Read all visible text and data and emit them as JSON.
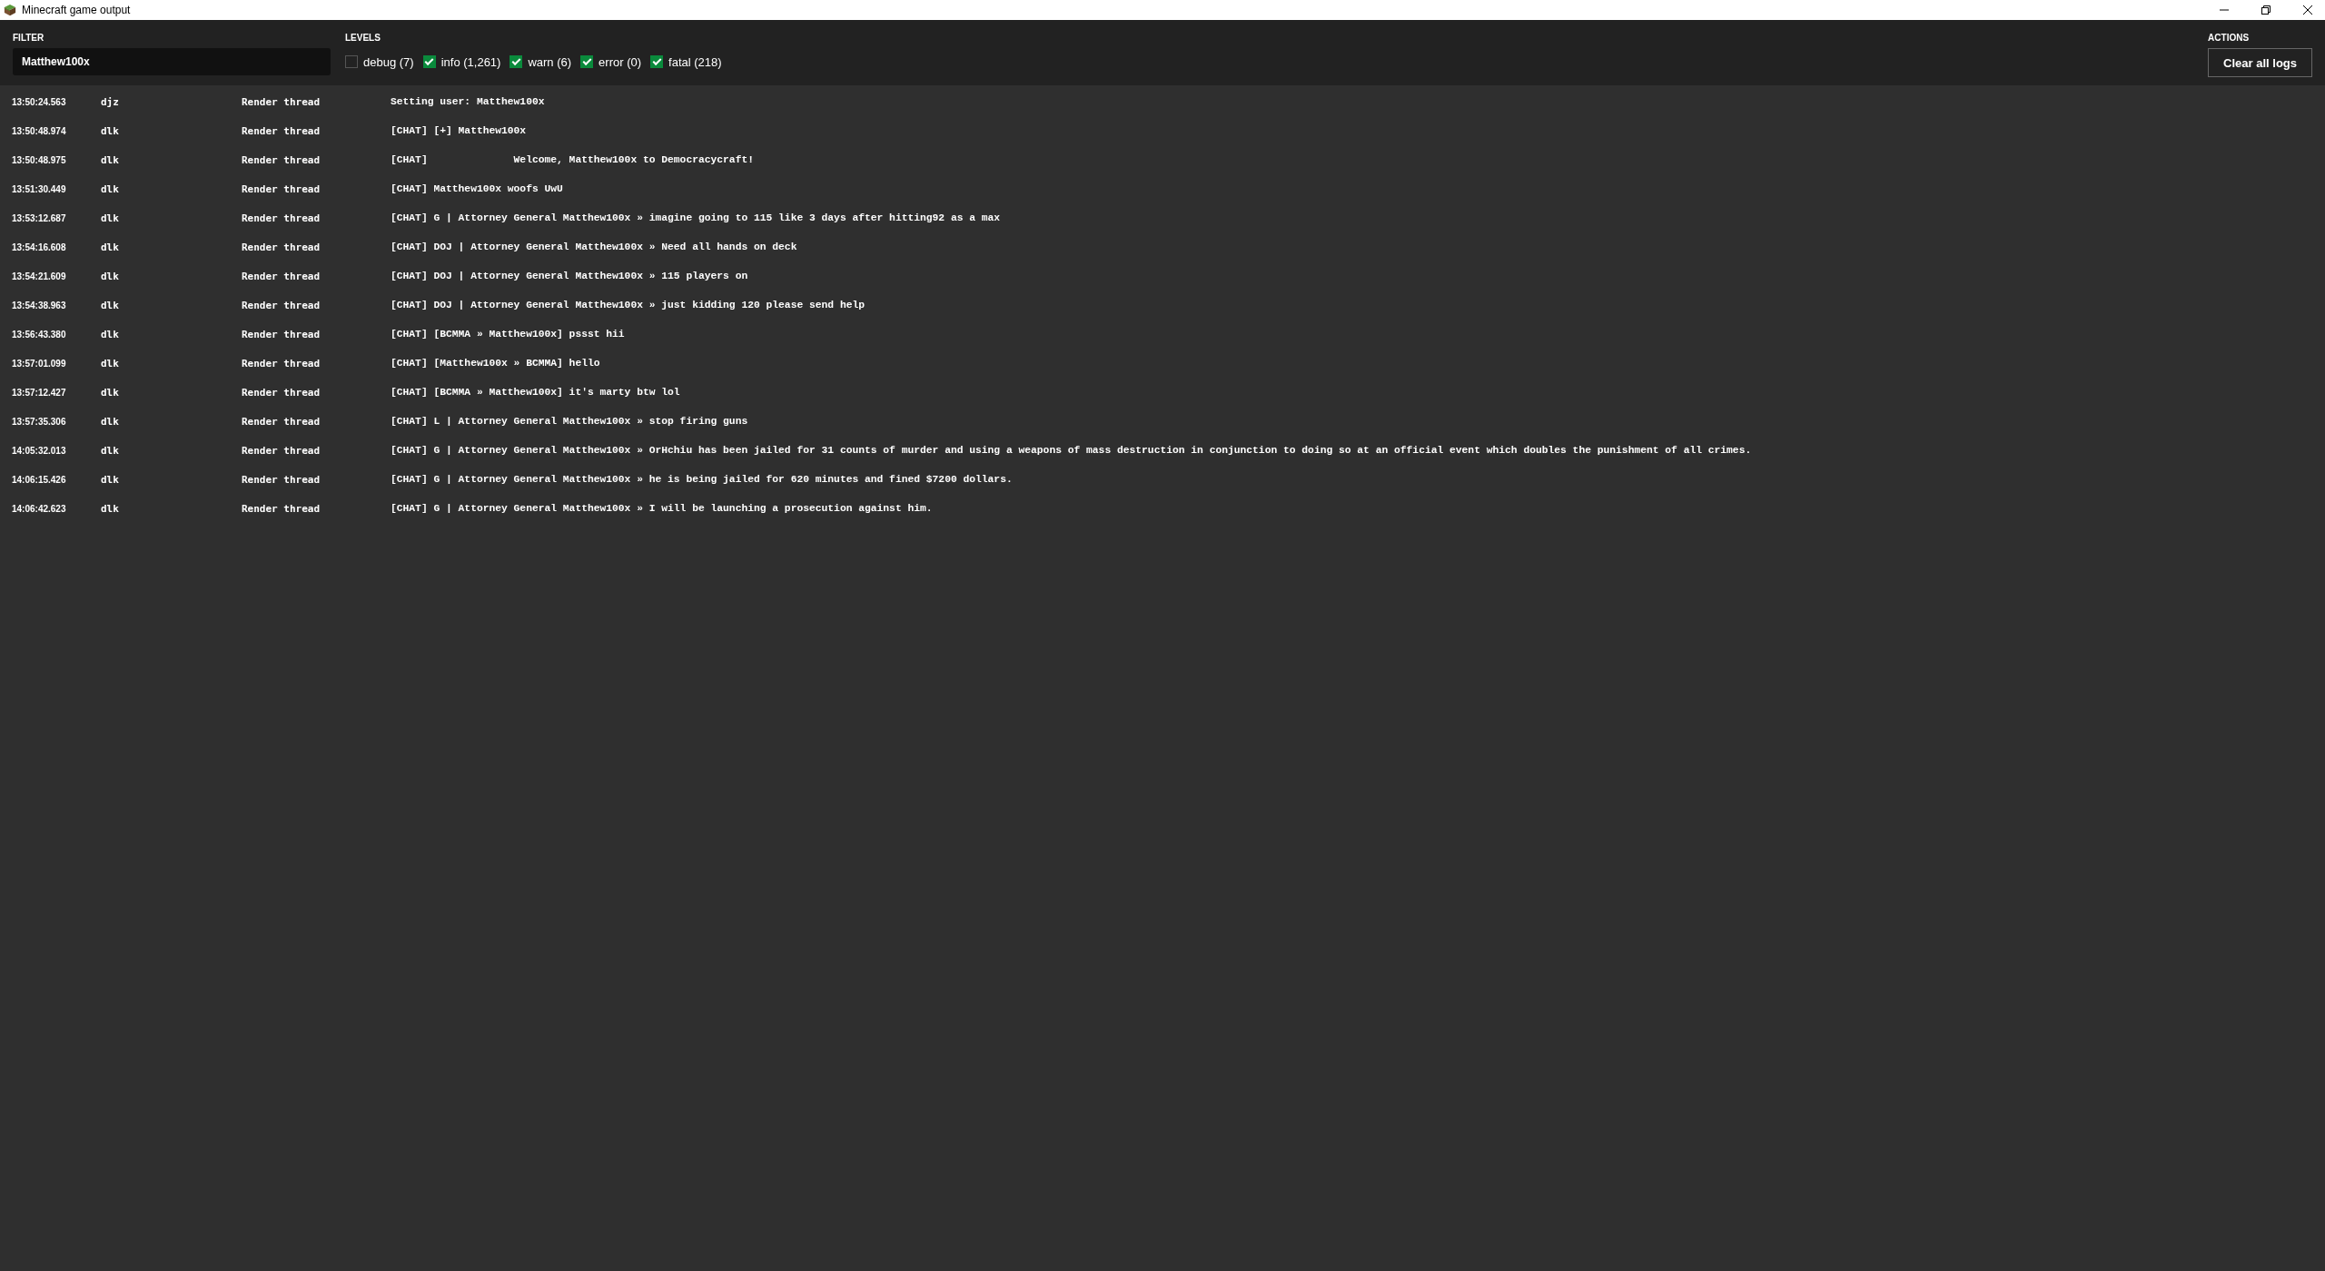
{
  "window": {
    "title": "Minecraft game output"
  },
  "filter": {
    "label": "FILTER",
    "value": "Matthew100x"
  },
  "levels": {
    "label": "LEVELS",
    "items": [
      {
        "label": "debug (7)",
        "checked": false
      },
      {
        "label": "info (1,261)",
        "checked": true
      },
      {
        "label": "warn (6)",
        "checked": true
      },
      {
        "label": "error (0)",
        "checked": true
      },
      {
        "label": "fatal (218)",
        "checked": true
      }
    ]
  },
  "actions": {
    "label": "ACTIONS",
    "buttons": [
      "Clear all logs"
    ]
  },
  "log": [
    {
      "time": "13:50:24.563",
      "logger": "djz",
      "thread": "Render thread",
      "message": "Setting user: Matthew100x"
    },
    {
      "time": "13:50:48.974",
      "logger": "dlk",
      "thread": "Render thread",
      "message": "[CHAT] [+] Matthew100x"
    },
    {
      "time": "13:50:48.975",
      "logger": "dlk",
      "thread": "Render thread",
      "message": "[CHAT]              Welcome, Matthew100x to Democracycraft!"
    },
    {
      "time": "13:51:30.449",
      "logger": "dlk",
      "thread": "Render thread",
      "message": "[CHAT] Matthew100x woofs UwU"
    },
    {
      "time": "13:53:12.687",
      "logger": "dlk",
      "thread": "Render thread",
      "message": "[CHAT] G | Attorney General Matthew100x » imagine going to 115 like 3 days after hitting92 as a max"
    },
    {
      "time": "13:54:16.608",
      "logger": "dlk",
      "thread": "Render thread",
      "message": "[CHAT] DOJ | Attorney General Matthew100x » Need all hands on deck"
    },
    {
      "time": "13:54:21.609",
      "logger": "dlk",
      "thread": "Render thread",
      "message": "[CHAT] DOJ | Attorney General Matthew100x » 115 players on"
    },
    {
      "time": "13:54:38.963",
      "logger": "dlk",
      "thread": "Render thread",
      "message": "[CHAT] DOJ | Attorney General Matthew100x » just kidding 120 please send help"
    },
    {
      "time": "13:56:43.380",
      "logger": "dlk",
      "thread": "Render thread",
      "message": "[CHAT] [BCMMA » Matthew100x] pssst hii"
    },
    {
      "time": "13:57:01.099",
      "logger": "dlk",
      "thread": "Render thread",
      "message": "[CHAT] [Matthew100x » BCMMA] hello"
    },
    {
      "time": "13:57:12.427",
      "logger": "dlk",
      "thread": "Render thread",
      "message": "[CHAT] [BCMMA » Matthew100x] it's marty btw lol"
    },
    {
      "time": "13:57:35.306",
      "logger": "dlk",
      "thread": "Render thread",
      "message": "[CHAT] L | Attorney General Matthew100x » stop firing guns"
    },
    {
      "time": "14:05:32.013",
      "logger": "dlk",
      "thread": "Render thread",
      "message": "[CHAT] G | Attorney General Matthew100x » OrHchiu has been jailed for 31 counts of murder and using a weapons of mass destruction in conjunction to doing so at an official event which doubles the punishment of all crimes."
    },
    {
      "time": "14:06:15.426",
      "logger": "dlk",
      "thread": "Render thread",
      "message": "[CHAT] G | Attorney General Matthew100x » he is being jailed for 620 minutes and fined $7200 dollars."
    },
    {
      "time": "14:06:42.623",
      "logger": "dlk",
      "thread": "Render thread",
      "message": "[CHAT] G | Attorney General Matthew100x » I will be launching a prosecution against him."
    }
  ]
}
